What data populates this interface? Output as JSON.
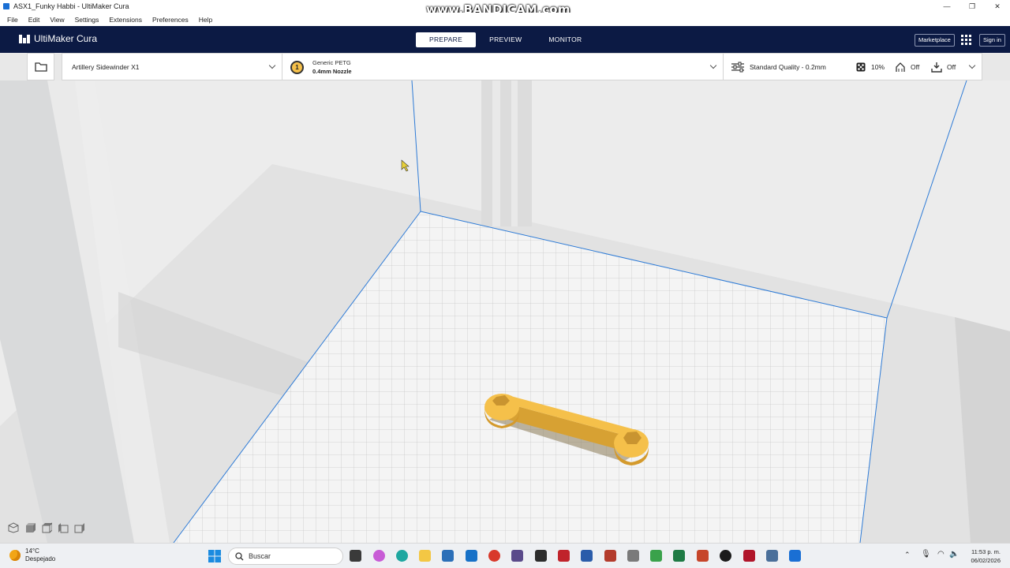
{
  "window": {
    "title": "ASX1_Funky Habbi - UltiMaker Cura"
  },
  "watermark": "www.BANDICAM.com",
  "menu": [
    "File",
    "Edit",
    "View",
    "Settings",
    "Extensions",
    "Preferences",
    "Help"
  ],
  "header": {
    "app_name": "UltiMaker Cura",
    "stages": [
      "PREPARE",
      "PREVIEW",
      "MONITOR"
    ],
    "active_stage": "PREPARE",
    "marketplace": "Marketplace",
    "sign_in": "Sign in"
  },
  "toolbar": {
    "printer": "Artillery Sidewinder X1",
    "extruder_number": "1",
    "material": "Generic PETG",
    "nozzle": "0.4mm Nozzle",
    "profile": "Standard Quality - 0.2mm",
    "infill": "10%",
    "support": "Off",
    "adhesion": "Off"
  },
  "colors": {
    "header": "#0c1a44",
    "model": "#f5c04a",
    "build_plate_edge": "#2e7bd6"
  },
  "taskbar": {
    "temperature": "14°C",
    "weather": "Despejado",
    "search_placeholder": "Buscar",
    "time": "11:53 p. m.",
    "date": "06/02/2026"
  }
}
